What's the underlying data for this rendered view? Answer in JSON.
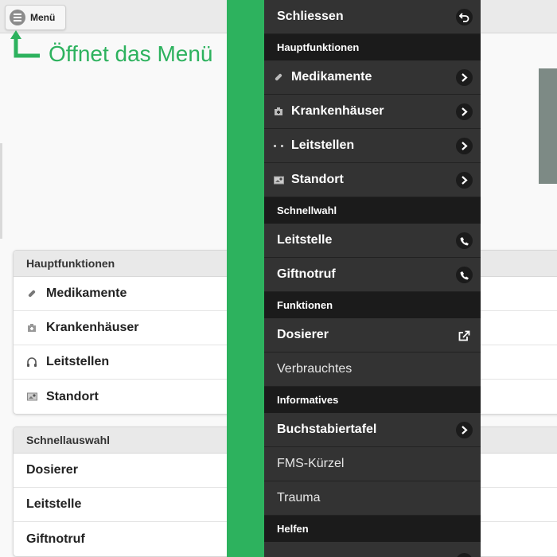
{
  "header": {
    "menu_label": "Menü"
  },
  "annotation": {
    "hint_text": "Öffnet das Menü",
    "accent_color": "#2db25e"
  },
  "background": {
    "main_section": {
      "title": "Hauptfunktionen",
      "items": [
        {
          "label": "Medikamente",
          "icon": "pill-icon"
        },
        {
          "label": "Krankenhäuser",
          "icon": "hospital-icon"
        },
        {
          "label": "Leitstellen",
          "icon": "headset-icon"
        },
        {
          "label": "Standort",
          "icon": "map-icon"
        }
      ]
    },
    "quick_section": {
      "title": "Schnellauswahl",
      "items": [
        {
          "label": "Dosierer"
        },
        {
          "label": "Leitstelle"
        },
        {
          "label": "Giftnotruf"
        }
      ]
    }
  },
  "menu": {
    "close_label": "Schliessen",
    "sections": [
      {
        "title": "Hauptfunktionen",
        "items": [
          {
            "label": "Medikamente",
            "icon": "pill-icon",
            "action": "chevron-right-icon"
          },
          {
            "label": "Krankenhäuser",
            "icon": "hospital-icon",
            "action": "chevron-right-icon"
          },
          {
            "label": "Leitstellen",
            "icon": "headset-icon",
            "action": "chevron-right-icon"
          },
          {
            "label": "Standort",
            "icon": "map-icon",
            "action": "chevron-right-icon"
          }
        ]
      },
      {
        "title": "Schnellwahl",
        "items": [
          {
            "label": "Leitstelle",
            "action": "phone-icon"
          },
          {
            "label": "Giftnotruf",
            "action": "phone-icon"
          }
        ]
      },
      {
        "title": "Funktionen",
        "items": [
          {
            "label": "Dosierer",
            "action": "external-link-icon"
          },
          {
            "label": "Verbrauchtes"
          }
        ]
      },
      {
        "title": "Informatives",
        "items": [
          {
            "label": "Buchstabiertafel",
            "action": "chevron-right-icon"
          },
          {
            "label": "FMS-Kürzel"
          },
          {
            "label": "Trauma"
          }
        ]
      },
      {
        "title": "Helfen",
        "items": []
      }
    ]
  }
}
